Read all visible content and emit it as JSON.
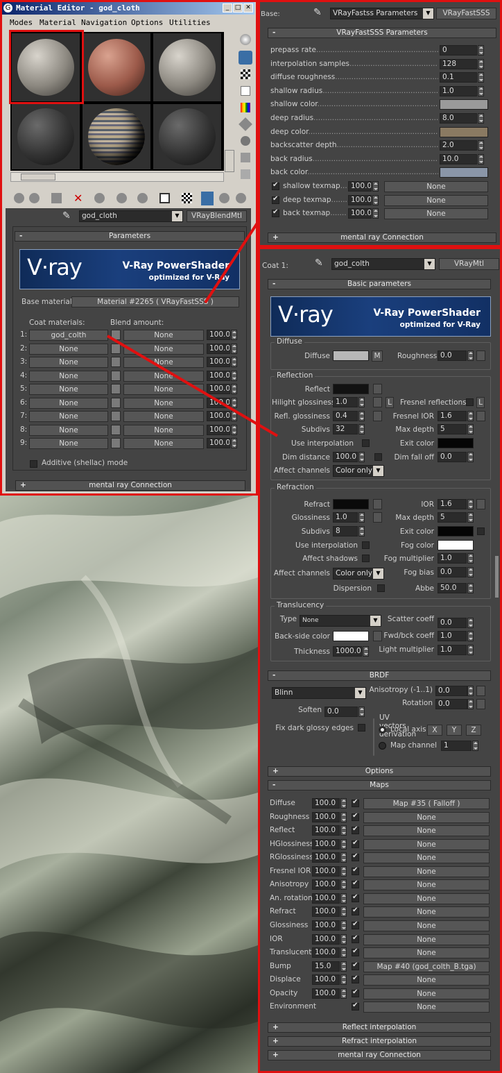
{
  "me": {
    "title": "Material Editor - god_cloth",
    "menu": [
      "Modes",
      "Material",
      "Navigation",
      "Options",
      "Utilities"
    ],
    "mat_name": "god_cloth",
    "mat_type": "VRayBlendMtl",
    "params_title": "Parameters",
    "vray_logo": "V·ray",
    "vray_title": "V-Ray PowerShader",
    "vray_sub": "optimized for V-Ray",
    "base_label": "Base material:",
    "base_value": "Material #2265  ( VRayFastSSS )",
    "coat_hdr": "Coat materials:",
    "blend_hdr": "Blend amount:",
    "rows": [
      {
        "n": "1:",
        "coat": "god_colth",
        "blend": "None",
        "amt": "100.0"
      },
      {
        "n": "2:",
        "coat": "None",
        "blend": "None",
        "amt": "100.0"
      },
      {
        "n": "3:",
        "coat": "None",
        "blend": "None",
        "amt": "100.0"
      },
      {
        "n": "4:",
        "coat": "None",
        "blend": "None",
        "amt": "100.0"
      },
      {
        "n": "5:",
        "coat": "None",
        "blend": "None",
        "amt": "100.0"
      },
      {
        "n": "6:",
        "coat": "None",
        "blend": "None",
        "amt": "100.0"
      },
      {
        "n": "7:",
        "coat": "None",
        "blend": "None",
        "amt": "100.0"
      },
      {
        "n": "8:",
        "coat": "None",
        "blend": "None",
        "amt": "100.0"
      },
      {
        "n": "9:",
        "coat": "None",
        "blend": "None",
        "amt": "100.0"
      }
    ],
    "additive": "Additive (shellac) mode",
    "mr": "mental ray Connection"
  },
  "sss": {
    "base_lbl": "Base:",
    "dd": "VRayFastss Parameters",
    "type": "VRayFastSSS",
    "title": "VRayFastSSS Parameters",
    "rows": [
      {
        "l": "prepass rate",
        "v": "0"
      },
      {
        "l": "interpolation samples",
        "v": "128"
      },
      {
        "l": "diffuse roughness",
        "v": "0.1"
      },
      {
        "l": "shallow radius",
        "v": "1.0"
      },
      {
        "l": "shallow color",
        "v": ""
      },
      {
        "l": "deep radius",
        "v": "8.0"
      },
      {
        "l": "deep color",
        "v": ""
      },
      {
        "l": "backscatter depth",
        "v": "2.0"
      },
      {
        "l": "back radius",
        "v": "10.0"
      },
      {
        "l": "back color",
        "v": ""
      }
    ],
    "tex": [
      {
        "l": "shallow texmap",
        "v": "100.0",
        "m": "None"
      },
      {
        "l": "deep texmap",
        "v": "100.0",
        "m": "None"
      },
      {
        "l": "back texmap",
        "v": "100.0",
        "m": "None"
      }
    ],
    "mr": "mental ray Connection"
  },
  "coat": {
    "lbl": "Coat 1:",
    "name": "god_colth",
    "type": "VRayMtl",
    "basic": "Basic parameters",
    "diffuse_grp": "Diffuse",
    "diffuse": "Diffuse",
    "m": "M",
    "roughness": "Roughness",
    "roughness_v": "0.0",
    "refl_grp": "Reflection",
    "reflect": "Reflect",
    "hg": "Hilight glossiness",
    "hg_v": "1.0",
    "L": "L",
    "fresnel": "Fresnel reflections",
    "rg": "Refl. glossiness",
    "rg_v": "0.4",
    "fior": "Fresnel IOR",
    "fior_v": "1.6",
    "subdivs": "Subdivs",
    "subdivs_v": "32",
    "maxd": "Max depth",
    "maxd_v": "5",
    "useint": "Use interpolation",
    "exitc": "Exit color",
    "dimd": "Dim distance",
    "dimd_v": "100.0",
    "dimf": "Dim fall off",
    "dimf_v": "0.0",
    "affc": "Affect channels",
    "affc_v": "Color only",
    "refr_grp": "Refraction",
    "refract": "Refract",
    "ior": "IOR",
    "ior_v": "1.6",
    "gl": "Glossiness",
    "gl_v": "1.0",
    "rmaxd_v": "5",
    "rsub_v": "8",
    "fogc": "Fog color",
    "affs": "Affect shadows",
    "fogm": "Fog multiplier",
    "fogm_v": "1.0",
    "fogb": "Fog bias",
    "fogb_v": "0.0",
    "disp": "Dispersion",
    "abbe": "Abbe",
    "abbe_v": "50.0",
    "trans_grp": "Translucency",
    "type_l": "Type",
    "type_v": "None",
    "scat": "Scatter coeff",
    "scat_v": "0.0",
    "bsc": "Back-side color",
    "fwd": "Fwd/bck coeff",
    "fwd_v": "1.0",
    "thick": "Thickness",
    "thick_v": "1000.0",
    "lm": "Light multiplier",
    "lm_v": "1.0",
    "brdf": "BRDF",
    "blinn": "Blinn",
    "aniso": "Anisotropy (-1..1)",
    "aniso_v": "0.0",
    "rot": "Rotation",
    "rot_v": "0.0",
    "soften": "Soften",
    "soften_v": "0.0",
    "uvgrp": "UV vectors derivation",
    "fix": "Fix dark glossy edges",
    "local": "Local axis",
    "x": "X",
    "y": "Y",
    "z": "Z",
    "mapch": "Map channel",
    "mapch_v": "1",
    "options": "Options",
    "maps": "Maps",
    "maprows": [
      {
        "l": "Diffuse",
        "v": "100.0",
        "m": "Map #35  ( Falloff )"
      },
      {
        "l": "Roughness",
        "v": "100.0",
        "m": "None"
      },
      {
        "l": "Reflect",
        "v": "100.0",
        "m": "None"
      },
      {
        "l": "HGlossiness",
        "v": "100.0",
        "m": "None"
      },
      {
        "l": "RGlossiness",
        "v": "100.0",
        "m": "None"
      },
      {
        "l": "Fresnel IOR",
        "v": "100.0",
        "m": "None"
      },
      {
        "l": "Anisotropy",
        "v": "100.0",
        "m": "None"
      },
      {
        "l": "An. rotation",
        "v": "100.0",
        "m": "None"
      },
      {
        "l": "Refract",
        "v": "100.0",
        "m": "None"
      },
      {
        "l": "Glossiness",
        "v": "100.0",
        "m": "None"
      },
      {
        "l": "IOR",
        "v": "100.0",
        "m": "None"
      },
      {
        "l": "Translucent",
        "v": "100.0",
        "m": "None"
      },
      {
        "l": "Bump",
        "v": "15.0",
        "m": "Map #40 (god_colth_B.tga)"
      },
      {
        "l": "Displace",
        "v": "100.0",
        "m": "None"
      },
      {
        "l": "Opacity",
        "v": "100.0",
        "m": "None"
      },
      {
        "l": "Environment",
        "v": "",
        "m": "None"
      }
    ],
    "ri": "Reflect interpolation",
    "fi": "Refract interpolation",
    "mr": "mental ray Connection"
  },
  "colors": {
    "accent_red": "#e01010",
    "shallow": "#9a9a9a",
    "deep": "#8a7a62",
    "back": "#8a96a8",
    "diffuse": "#b8b8b8",
    "white": "#ffffff",
    "black": "#0a0a0a"
  }
}
